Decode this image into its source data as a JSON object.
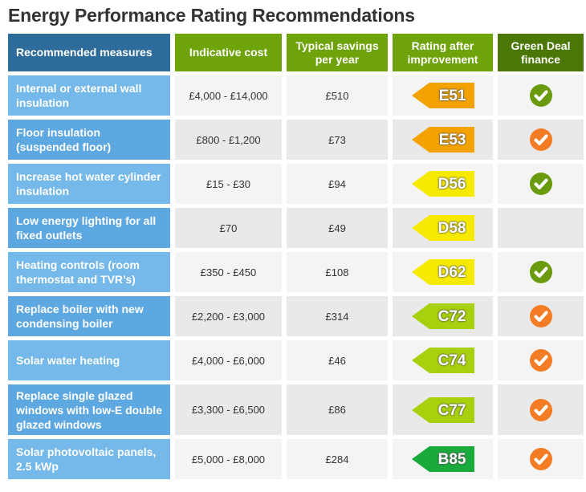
{
  "title": "Energy Performance Rating Recommendations",
  "colors": {
    "E": "#f4a200",
    "D": "#f6ea00",
    "C": "#a7d10c",
    "B": "#1aaa3c",
    "check_green": "#6a9a0e",
    "check_orange": "#f47c25"
  },
  "chart_data": {
    "type": "table",
    "title": "Energy Performance Rating Recommendations",
    "columns": [
      "Recommended measures",
      "Indicative cost",
      "Typical savings per year",
      "Rating after improvement",
      "Green Deal finance"
    ],
    "rows": [
      {
        "measure": "Internal or external wall insulation",
        "cost": "£4,000 -  £14,000",
        "savings": "£510",
        "rating": "E51",
        "band": "E",
        "finance": "green"
      },
      {
        "measure": "Floor insulation (suspended floor)",
        "cost": "£800 -  £1,200",
        "savings": "£73",
        "rating": "E53",
        "band": "E",
        "finance": "orange"
      },
      {
        "measure": "Increase hot water cylinder insulation",
        "cost": "£15 -  £30",
        "savings": "£94",
        "rating": "D56",
        "band": "D",
        "finance": "green"
      },
      {
        "measure": "Low energy lighting for all fixed outlets",
        "cost": "£70",
        "savings": "£49",
        "rating": "D58",
        "band": "D",
        "finance": "none"
      },
      {
        "measure": "Heating controls (room thermostat and TVR’s)",
        "cost": "£350 -  £450",
        "savings": "£108",
        "rating": "D62",
        "band": "D",
        "finance": "green"
      },
      {
        "measure": "Replace boiler with new condensing boiler",
        "cost": "£2,200 -  £3,000",
        "savings": "£314",
        "rating": "C72",
        "band": "C",
        "finance": "orange"
      },
      {
        "measure": "Solar water heating",
        "cost": "£4,000 -  £6,000",
        "savings": "£46",
        "rating": "C74",
        "band": "C",
        "finance": "orange"
      },
      {
        "measure": "Replace single glazed windows with low-E double glazed windows",
        "cost": "£3,300 -  £6,500",
        "savings": "£86",
        "rating": "C77",
        "band": "C",
        "finance": "orange"
      },
      {
        "measure": "Solar photovoltaic panels, 2.5 kWp",
        "cost": "£5,000 -  £8,000",
        "savings": "£284",
        "rating": "B85",
        "band": "B",
        "finance": "orange"
      }
    ]
  }
}
